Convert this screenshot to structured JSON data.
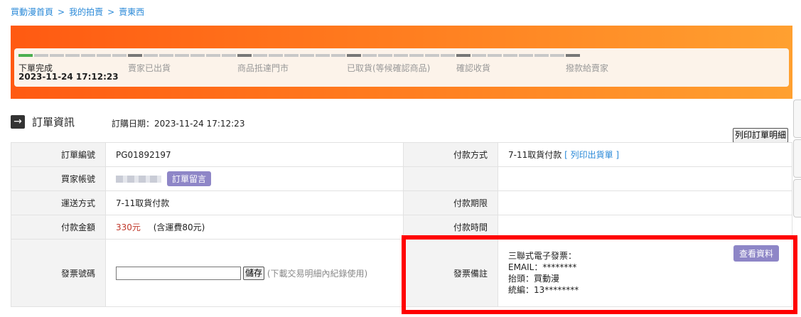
{
  "breadcrumb": [
    "買動漫首頁",
    "我的拍賣",
    "賣東西"
  ],
  "breadcrumb_sep": ">",
  "progress": {
    "steps": [
      {
        "label": "下單完成",
        "done": true
      },
      {
        "label": "賣家已出貨",
        "done": false
      },
      {
        "label": "商品抵達門市",
        "done": false
      },
      {
        "label": "已取貨(等候確認商品)",
        "done": false
      },
      {
        "label": "確認收貨",
        "done": false
      },
      {
        "label": "撥款給賣家",
        "done": false
      }
    ],
    "completed_date": "2023-11-24 17:12:23"
  },
  "section": {
    "arrow_icon": "→",
    "title": "訂單資訊",
    "order_date": "訂購日期：2023-11-24 17:12:23"
  },
  "print_button": "列印訂單明細",
  "table": {
    "order_no_label": "訂單編號",
    "order_no": "PG01892197",
    "payment_method_label": "付款方式",
    "payment_method": "7-11取貨付款",
    "print_shipping_link": "[ 列印出貨單 ]",
    "buyer_label": "買家帳號",
    "message_button": "訂單留言",
    "shipping_label": "運送方式",
    "shipping": "7-11取貨付款",
    "payment_deadline_label": "付款期限",
    "amount_label": "付款金額",
    "amount": "330元",
    "amount_note": "(含運費80元)",
    "payment_time_label": "付款時間",
    "invoice_no_label": "發票號碼",
    "invoice_input_value": "",
    "save_button": "儲存",
    "invoice_hint": "(下載交易明細內紀錄使用)",
    "invoice_memo_label": "發票備註",
    "invoice_memo": {
      "line1": "三聯式電子發票：",
      "line2": "EMAIL：********",
      "line3": "抬頭：買動漫",
      "line4": "統編：13********"
    },
    "view_button": "查看資料"
  },
  "colors": {
    "banner_start": "#ff5a12",
    "banner_end": "#ffa030",
    "link": "#2b8ad8",
    "accent_button": "#8e86c7",
    "highlight_box": "#ff0000",
    "price": "#c0392b"
  }
}
